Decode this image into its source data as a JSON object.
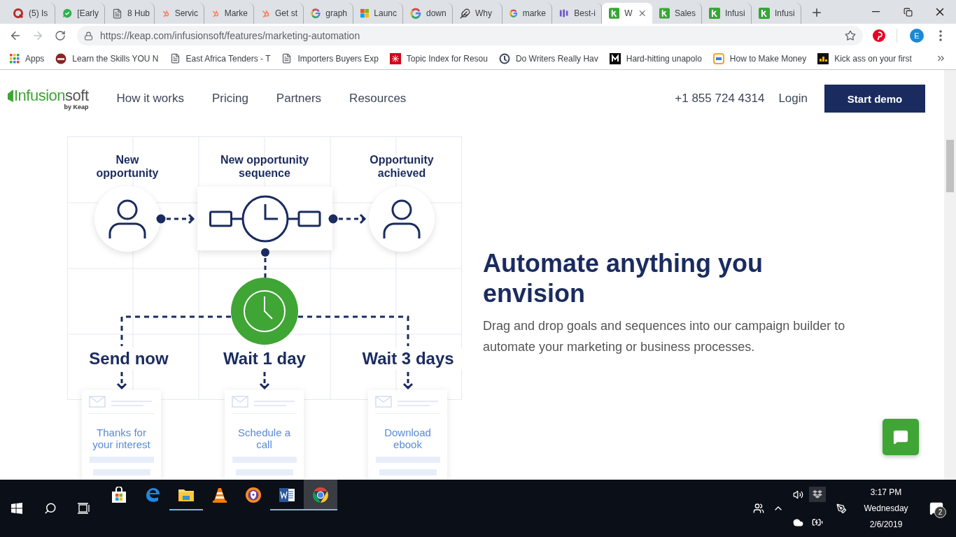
{
  "browser": {
    "tabs": [
      {
        "title": "(5) Is",
        "selected": false
      },
      {
        "title": "[Early",
        "selected": false
      },
      {
        "title": "8 Hub",
        "selected": false
      },
      {
        "title": "Servic",
        "selected": false
      },
      {
        "title": "Marke",
        "selected": false
      },
      {
        "title": "Get st",
        "selected": false
      },
      {
        "title": "graph",
        "selected": false
      },
      {
        "title": "Launc",
        "selected": false
      },
      {
        "title": "down",
        "selected": false
      },
      {
        "title": "Why",
        "selected": false
      },
      {
        "title": "marke",
        "selected": false
      },
      {
        "title": "Best-i",
        "selected": false
      },
      {
        "title": "W",
        "selected": true
      },
      {
        "title": "Sales",
        "selected": false
      },
      {
        "title": "Infusi",
        "selected": false
      },
      {
        "title": "Infusi",
        "selected": false
      }
    ],
    "url": "https://keap.com/infusionsoft/features/marketing-automation",
    "profile_initial": "E",
    "bookmarks": [
      "Apps",
      "Learn the Skills YOU N",
      "East Africa Tenders - T",
      "Importers Buyers Exp",
      "Topic Index for Resou",
      "Do Writers Really Hav",
      "Hard-hitting unapolo",
      "How to Make Money",
      "Kick ass on your first"
    ]
  },
  "site": {
    "brand": {
      "main": "Infusion",
      "suffix": "soft",
      "tagline": "by Keap"
    },
    "nav": [
      "How it works",
      "Pricing",
      "Partners",
      "Resources"
    ],
    "phone": "+1 855 724 4314",
    "login": "Login",
    "cta": "Start demo"
  },
  "diagram": {
    "stages": [
      "New opportunity",
      "New opportunity sequence",
      "Opportunity achieved"
    ],
    "branches": [
      {
        "label": "Send now",
        "card": "Thanks for your interest"
      },
      {
        "label": "Wait 1 day",
        "card": "Schedule a call"
      },
      {
        "label": "Wait 3 days",
        "card": "Download ebook"
      }
    ]
  },
  "feature": {
    "heading": "Automate anything you envision",
    "body": "Drag and drop goals and sequences into our campaign builder to automate your marketing or business processes."
  },
  "taskbar": {
    "apps": [
      {
        "running": false,
        "selected": false
      },
      {
        "running": false,
        "selected": false
      },
      {
        "running": true,
        "selected": false
      },
      {
        "running": false,
        "selected": false
      },
      {
        "running": false,
        "selected": false
      },
      {
        "running": true,
        "selected": false
      },
      {
        "running": true,
        "selected": true
      }
    ],
    "clock": {
      "time": "3:17 PM",
      "day": "Wednesday",
      "date": "2/6/2019"
    },
    "notification_count": "2"
  }
}
